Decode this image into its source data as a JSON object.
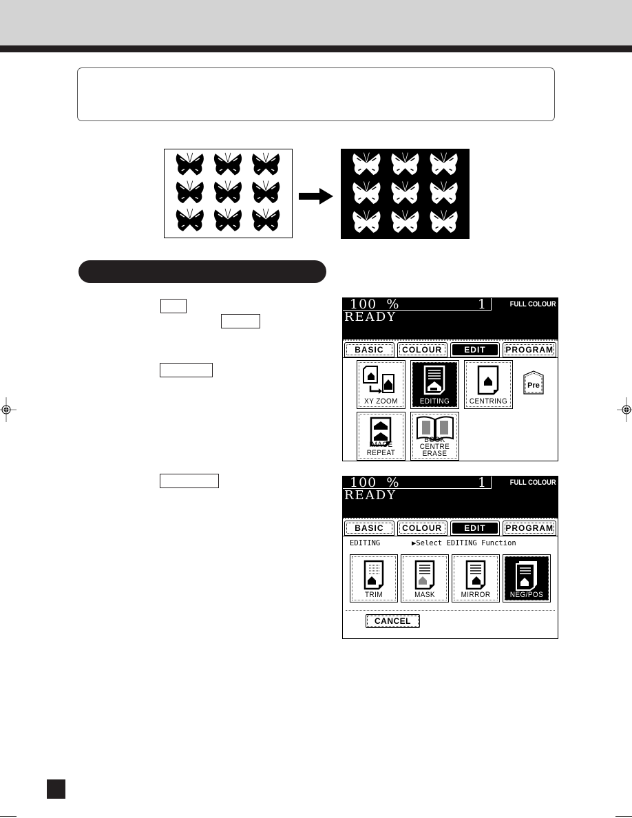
{
  "document": {
    "note_box_text": "",
    "section_heading": "",
    "key_labels": [
      "",
      "",
      "",
      ""
    ]
  },
  "illustration": {
    "original_label": "butterflies-original",
    "result_label": "butterflies-negative",
    "arrow": "right-arrow-icon"
  },
  "panel1": {
    "zoom": "100  %",
    "copies": "1",
    "color_mode": "FULL COLOUR",
    "status": "READY",
    "tabs": [
      {
        "label": "BASIC",
        "active": false
      },
      {
        "label": "COLOUR",
        "active": false
      },
      {
        "label": "EDIT",
        "active": true
      },
      {
        "label": "PROGRAM",
        "active": false
      }
    ],
    "functions": [
      {
        "label": "XY ZOOM",
        "selected": false
      },
      {
        "label": "EDITING",
        "selected": true
      },
      {
        "label": "CENTRING",
        "selected": false
      },
      {
        "label": "IMAGE REPEAT",
        "selected": false
      },
      {
        "label": "BOOK CENTRE",
        "label2": "ERASE",
        "selected": false
      }
    ],
    "preset_label": "Pre"
  },
  "panel2": {
    "zoom": "100  %",
    "copies": "1",
    "color_mode": "FULL COLOUR",
    "status": "READY",
    "tabs": [
      {
        "label": "BASIC",
        "active": false
      },
      {
        "label": "COLOUR",
        "active": false
      },
      {
        "label": "EDIT",
        "active": true
      },
      {
        "label": "PROGRAM",
        "active": false
      }
    ],
    "screen_title": "EDITING",
    "instruction": "▶Select EDITING Function",
    "functions": [
      {
        "label": "TRIM",
        "selected": false
      },
      {
        "label": "MASK",
        "selected": false
      },
      {
        "label": "MIRROR",
        "selected": false
      },
      {
        "label": "NEG/POS",
        "selected": true
      }
    ],
    "cancel_label": "CANCEL"
  }
}
